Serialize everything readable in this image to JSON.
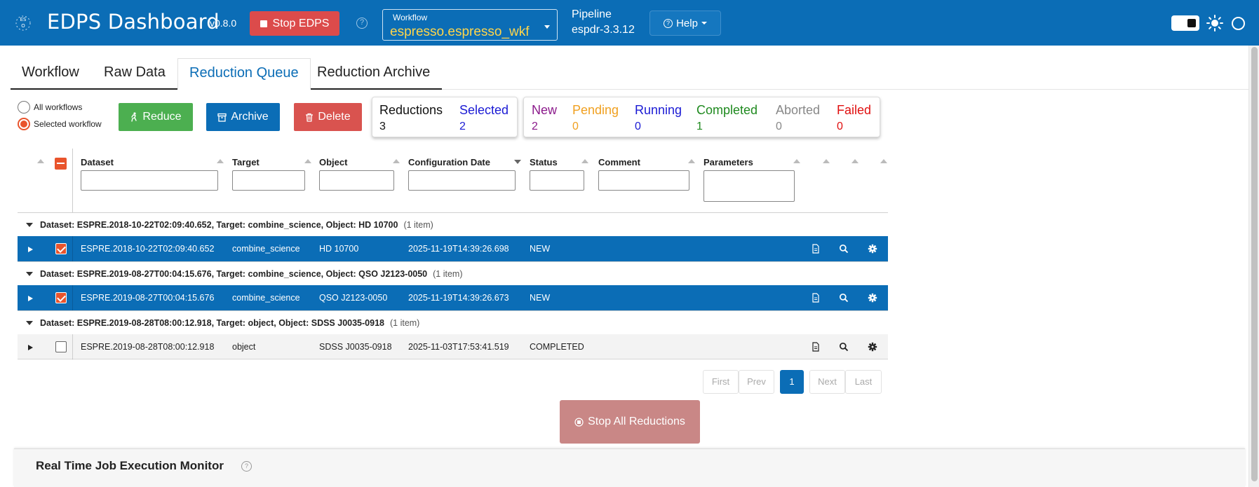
{
  "app": {
    "title": "EDPS Dashboard",
    "version": "v0.8.0",
    "stop_label": "Stop EDPS"
  },
  "workflow": {
    "label": "Workflow",
    "value": "espresso.espresso_wkf"
  },
  "pipeline": {
    "label": "Pipeline",
    "value": "espdr-3.3.12"
  },
  "help": {
    "label": "Help"
  },
  "tabs": [
    {
      "label": "Workflow",
      "active": false
    },
    {
      "label": "Raw Data",
      "active": false
    },
    {
      "label": "Reduction Queue",
      "active": true
    },
    {
      "label": "Reduction Archive",
      "active": false
    }
  ],
  "filter": {
    "all": "All workflows",
    "selected": "Selected workflow",
    "current": "selected"
  },
  "actions": {
    "reduce": "Reduce",
    "archive": "Archive",
    "delete": "Delete"
  },
  "summary": {
    "reductions_label": "Reductions",
    "reductions_value": "3",
    "selected_label": "Selected",
    "selected_value": "2"
  },
  "statuses": [
    {
      "label": "New",
      "value": "2",
      "color": "#8b1a8b"
    },
    {
      "label": "Pending",
      "value": "0",
      "color": "#f0a020"
    },
    {
      "label": "Running",
      "value": "0",
      "color": "#1a1ad4"
    },
    {
      "label": "Completed",
      "value": "1",
      "color": "#1f8a1f"
    },
    {
      "label": "Aborted",
      "value": "0",
      "color": "#888888"
    },
    {
      "label": "Failed",
      "value": "0",
      "color": "#e01010"
    }
  ],
  "columns": [
    "Dataset",
    "Target",
    "Object",
    "Configuration Date",
    "Status",
    "Comment",
    "Parameters"
  ],
  "groups": [
    {
      "header": "Dataset: ESPRE.2018-10-22T02:09:40.652, Target: combine_science, Object: HD 10700",
      "count": "(1 item)",
      "row": {
        "dataset": "ESPRE.2018-10-22T02:09:40.652",
        "target": "combine_science",
        "object": "HD 10700",
        "config_date": "2025-11-19T14:39:26.698",
        "status": "NEW",
        "selected": true
      }
    },
    {
      "header": "Dataset: ESPRE.2019-08-27T00:04:15.676, Target: combine_science, Object: QSO J2123-0050",
      "count": "(1 item)",
      "row": {
        "dataset": "ESPRE.2019-08-27T00:04:15.676",
        "target": "combine_science",
        "object": "QSO J2123-0050",
        "config_date": "2025-11-19T14:39:26.673",
        "status": "NEW",
        "selected": true
      }
    },
    {
      "header": "Dataset: ESPRE.2019-08-28T08:00:12.918, Target: object, Object: SDSS J0035-0918",
      "count": "(1 item)",
      "row": {
        "dataset": "ESPRE.2019-08-28T08:00:12.918",
        "target": "object",
        "object": "SDSS J0035-0918",
        "config_date": "2025-11-03T17:53:41.519",
        "status": "COMPLETED",
        "selected": false
      }
    }
  ],
  "pagination": {
    "first": "First",
    "prev": "Prev",
    "page": "1",
    "next": "Next",
    "last": "Last"
  },
  "stop_all": "Stop All Reductions",
  "monitor": {
    "title": "Real Time Job Execution Monitor"
  },
  "colors": {
    "brand": "#0b6db6",
    "accent": "#e9542c",
    "reduce": "#4caf50",
    "delete": "#d9534f"
  }
}
